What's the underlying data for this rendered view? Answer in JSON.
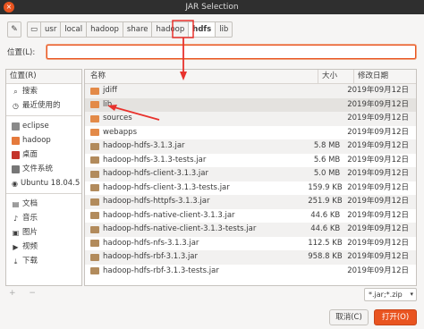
{
  "window": {
    "title": "JAR Selection",
    "close_glyph": "×"
  },
  "pathbar": {
    "edit_icon": "pencil-icon",
    "crumbs": [
      "usr",
      "local",
      "hadoop",
      "share",
      "hadoop",
      "hdfs",
      "lib"
    ],
    "active_crumb": "hdfs"
  },
  "location": {
    "label": "位置(L):",
    "value": ""
  },
  "sidebar": {
    "header": "位置(R)",
    "items": [
      {
        "label": "搜索",
        "icon": "search-icon"
      },
      {
        "label": "最近使用的",
        "icon": "clock-icon"
      },
      {
        "label": "eclipse",
        "icon": "folder-icon"
      },
      {
        "label": "hadoop",
        "icon": "folder-icon"
      },
      {
        "label": "桌面",
        "icon": "desktop-folder-icon"
      },
      {
        "label": "文件系统",
        "icon": "drive-icon"
      },
      {
        "label": "Ubuntu 18.04.5 ...",
        "icon": "disc-icon"
      },
      {
        "label": "文档",
        "icon": "documents-icon"
      },
      {
        "label": "音乐",
        "icon": "music-icon"
      },
      {
        "label": "图片",
        "icon": "pictures-icon"
      },
      {
        "label": "视频",
        "icon": "videos-icon"
      },
      {
        "label": "下载",
        "icon": "downloads-icon"
      }
    ],
    "add_glyph": "+",
    "remove_glyph": "−"
  },
  "filelist": {
    "headers": {
      "name": "名称",
      "size": "大小",
      "date": "修改日期"
    },
    "rows": [
      {
        "name": "jdiff",
        "size": "",
        "date": "2019年09月12日",
        "type": "dir"
      },
      {
        "name": "lib",
        "size": "",
        "date": "2019年09月12日",
        "type": "dir"
      },
      {
        "name": "sources",
        "size": "",
        "date": "2019年09月12日",
        "type": "dir"
      },
      {
        "name": "webapps",
        "size": "",
        "date": "2019年09月12日",
        "type": "dir"
      },
      {
        "name": "hadoop-hdfs-3.1.3.jar",
        "size": "5.8 MB",
        "date": "2019年09月12日",
        "type": "jar"
      },
      {
        "name": "hadoop-hdfs-3.1.3-tests.jar",
        "size": "5.6 MB",
        "date": "2019年09月12日",
        "type": "jar"
      },
      {
        "name": "hadoop-hdfs-client-3.1.3.jar",
        "size": "5.0 MB",
        "date": "2019年09月12日",
        "type": "jar"
      },
      {
        "name": "hadoop-hdfs-client-3.1.3-tests.jar",
        "size": "159.9 KB",
        "date": "2019年09月12日",
        "type": "jar"
      },
      {
        "name": "hadoop-hdfs-httpfs-3.1.3.jar",
        "size": "251.9 KB",
        "date": "2019年09月12日",
        "type": "jar"
      },
      {
        "name": "hadoop-hdfs-native-client-3.1.3.jar",
        "size": "44.6 KB",
        "date": "2019年09月12日",
        "type": "jar"
      },
      {
        "name": "hadoop-hdfs-native-client-3.1.3-tests.jar",
        "size": "44.6 KB",
        "date": "2019年09月12日",
        "type": "jar"
      },
      {
        "name": "hadoop-hdfs-nfs-3.1.3.jar",
        "size": "112.5 KB",
        "date": "2019年09月12日",
        "type": "jar"
      },
      {
        "name": "hadoop-hdfs-rbf-3.1.3.jar",
        "size": "958.8 KB",
        "date": "2019年09月12日",
        "type": "jar"
      },
      {
        "name": "hadoop-hdfs-rbf-3.1.3-tests.jar",
        "size": "",
        "date": "2019年09月12日",
        "type": "jar"
      }
    ],
    "selected_row": 1
  },
  "filter": {
    "value": "*.jar;*.zip"
  },
  "buttons": {
    "cancel": "取消(C)",
    "open": "打开(O)"
  },
  "colors": {
    "accent": "#e95420",
    "annotation": "#e8322d",
    "titlebar": "#2f2f2f"
  }
}
